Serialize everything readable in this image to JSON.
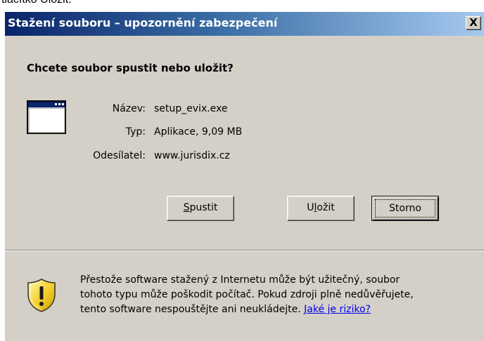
{
  "background_caption": "tlačítko Uložit.",
  "dialog": {
    "title": "Stažení souboru – upozornění zabezpečení",
    "close_label": "X",
    "question": "Chcete soubor spustit nebo uložit?",
    "file": {
      "icon": "application-window-icon",
      "name_label": "Název:",
      "name_value": "setup_evix.exe",
      "type_label": "Typ:",
      "type_value": "Aplikace, 9,09 MB",
      "from_label": "Odesílatel:",
      "from_value": "www.jurisdix.cz"
    },
    "buttons": {
      "run": {
        "accel": "S",
        "rest": "pustit"
      },
      "save": {
        "pre": "U",
        "accel": "l",
        "rest": "ožit"
      },
      "cancel": "Storno"
    },
    "warning": {
      "icon": "shield-warning-icon",
      "line1": "Přestože software stažený z Internetu může být užitečný, soubor",
      "line2": "tohoto typu může poškodit počítač. Pokud zdroji plně nedůvěřujete,",
      "line3": "tento software nespouštějte ani neukládejte.",
      "link": "Jaké je riziko?"
    },
    "colors": {
      "face": "#d4d0c8",
      "title_start": "#0a246a",
      "title_end": "#a6caf0",
      "link": "#0000ee"
    }
  }
}
